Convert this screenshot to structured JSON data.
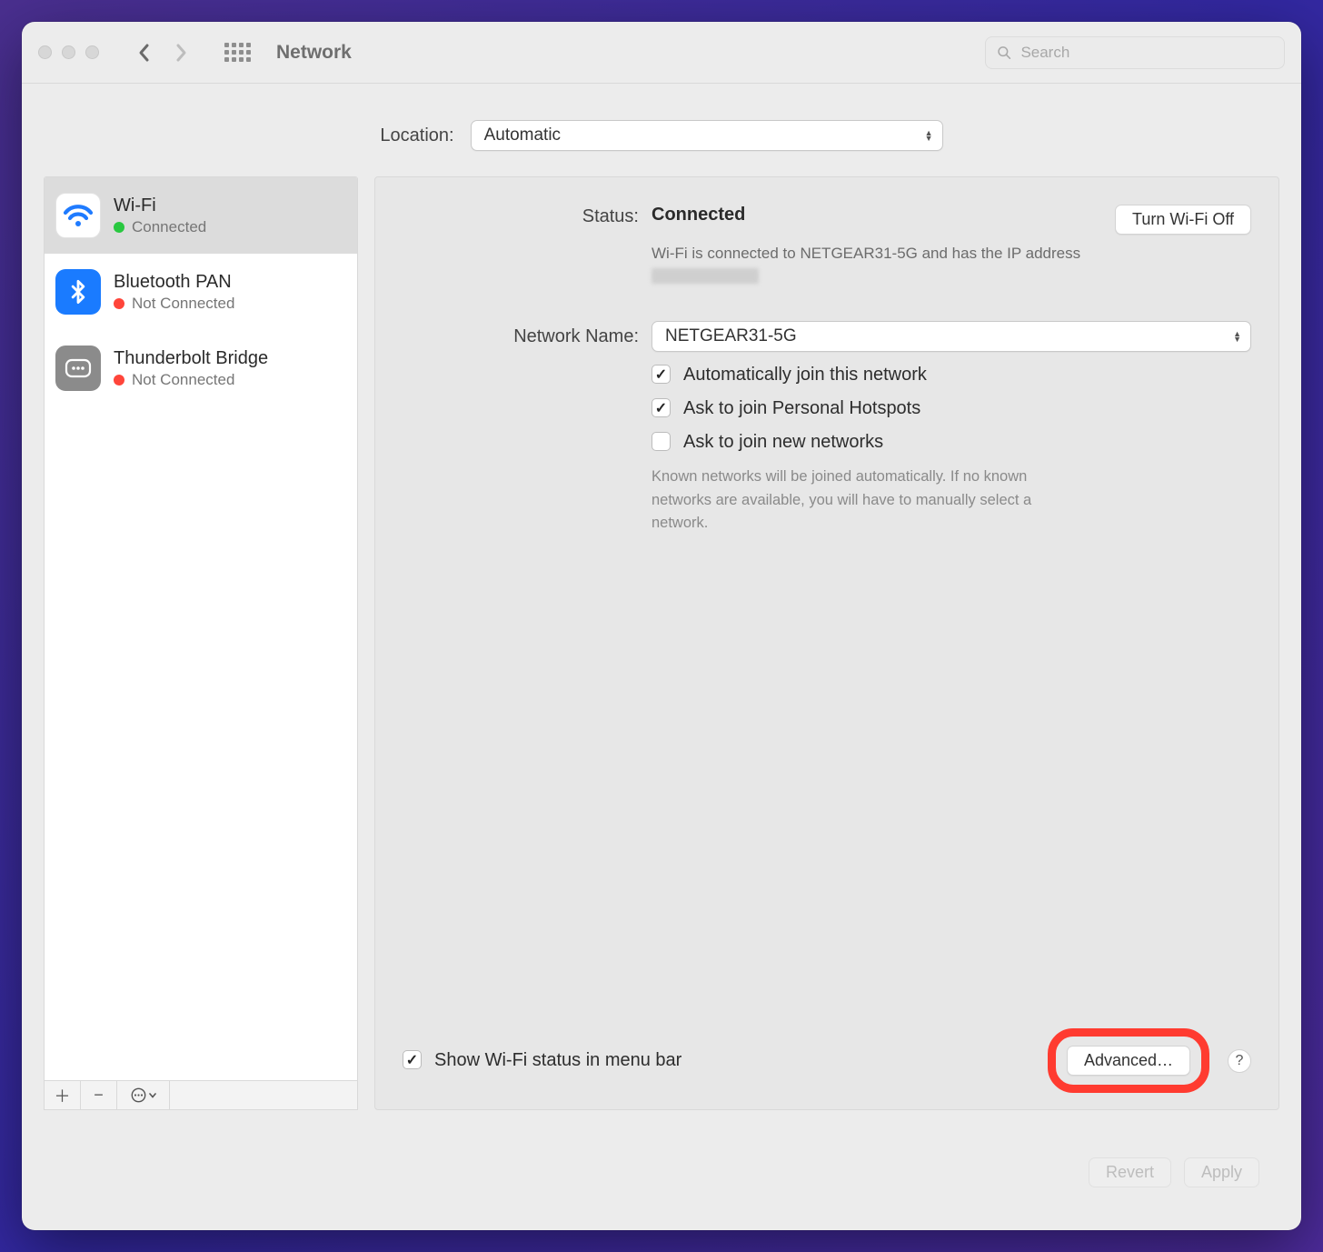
{
  "titlebar": {
    "title": "Network",
    "search_placeholder": "Search"
  },
  "location": {
    "label": "Location:",
    "value": "Automatic"
  },
  "services": [
    {
      "name": "Wi-Fi",
      "status_text": "Connected",
      "connected": true,
      "kind": "wifi"
    },
    {
      "name": "Bluetooth PAN",
      "status_text": "Not Connected",
      "connected": false,
      "kind": "bt"
    },
    {
      "name": "Thunderbolt Bridge",
      "status_text": "Not Connected",
      "connected": false,
      "kind": "tb"
    }
  ],
  "detail": {
    "status_label": "Status:",
    "status_value": "Connected",
    "toggle_wifi_label": "Turn Wi-Fi Off",
    "status_description": "Wi-Fi is connected to NETGEAR31-5G and has the IP address ",
    "network_name_label": "Network Name:",
    "network_name_value": "NETGEAR31-5G",
    "auto_join_label": "Automatically join this network",
    "ask_hotspot_label": "Ask to join Personal Hotspots",
    "ask_new_label": "Ask to join new networks",
    "ask_new_hint": "Known networks will be joined automatically. If no known networks are available, you will have to manually select a network.",
    "show_menubar_label": "Show Wi-Fi status in menu bar",
    "advanced_label": "Advanced…",
    "help_label": "?"
  },
  "footer": {
    "revert_label": "Revert",
    "apply_label": "Apply"
  }
}
